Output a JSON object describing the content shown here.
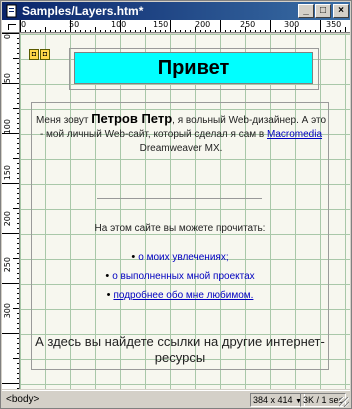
{
  "window": {
    "title": "Samples/Layers.htm*",
    "minimize_label": "_",
    "maximize_label": "□",
    "close_label": "×"
  },
  "rulers": {
    "horizontal_labels": [
      "0",
      "50",
      "100",
      "150",
      "200",
      "250",
      "300",
      "350"
    ],
    "vertical_labels": [
      "0",
      "50",
      "100",
      "150",
      "200",
      "250",
      "300"
    ]
  },
  "layers": {
    "marker_labels": [
      "◘",
      "◘"
    ],
    "hello": "Привет",
    "intro_before": "Меня зовут ",
    "intro_name": "Петров Петр",
    "intro_after": ", я вольный Web-дизайнер. А это - мой личный Web-сайт, который сделал я сам в ",
    "intro_link": "Macromedia",
    "intro_end": " Dreamweaver MX.",
    "can_read": "На этом сайте вы можете прочитать:",
    "links": [
      {
        "label": "о моих увлечениях;"
      },
      {
        "label": "о выполненных мной проектах"
      },
      {
        "label": "подробнее обо мне любимом."
      }
    ],
    "footer": "А здесь вы найдете ссылки на другие интернет-ресурсы"
  },
  "status": {
    "tag": "<body>",
    "window_size": "384 x 414",
    "download": "3K / 1 sec"
  }
}
